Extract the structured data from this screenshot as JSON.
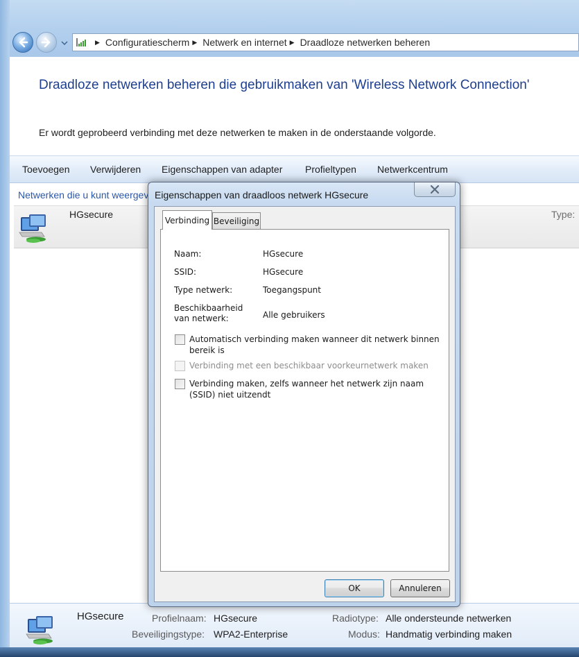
{
  "address_bar": {
    "crumbs": [
      "Configuratiescherm",
      "Netwerk en internet",
      "Draadloze netwerken beheren"
    ]
  },
  "page": {
    "title": "Draadloze netwerken beheren die gebruikmaken van 'Wireless Network Connection'",
    "description": "Er wordt geprobeerd verbinding met deze netwerken te maken in de onderstaande volgorde."
  },
  "toolbar": {
    "items": [
      "Toevoegen",
      "Verwijderen",
      "Eigenschappen van adapter",
      "Profieltypen",
      "Netwerkcentrum"
    ]
  },
  "network_list": {
    "header": "Netwerken die u kunt weergeven, wijzigen en opnieuw ordenen",
    "header_faint": "weergeven",
    "rows": [
      {
        "name": "HGsecure",
        "type_label": "Type:"
      }
    ]
  },
  "details": {
    "name": "HGsecure",
    "profile_name_label": "Profielnaam:",
    "profile_name": "HGsecure",
    "security_type_label": "Beveiligingstype:",
    "security_type": "WPA2-Enterprise",
    "radio_type_label": "Radiotype:",
    "radio_type": "Alle ondersteunde netwerken",
    "mode_label": "Modus:",
    "mode": "Handmatig verbinding maken"
  },
  "dialog": {
    "title": "Eigenschappen van draadloos netwerk HGsecure",
    "tabs": [
      "Verbinding",
      "Beveiliging"
    ],
    "active_tab": "Verbinding",
    "properties": [
      {
        "label": "Naam:",
        "value": "HGsecure"
      },
      {
        "label": "SSID:",
        "value": "HGsecure"
      },
      {
        "label": "Type netwerk:",
        "value": "Toegangspunt"
      },
      {
        "label": "Beschikbaarheid van netwerk:",
        "value": "Alle gebruikers"
      }
    ],
    "checkboxes": [
      {
        "label": "Automatisch verbinding maken wanneer dit netwerk binnen bereik is",
        "checked": false,
        "enabled": true
      },
      {
        "label": "Verbinding met een beschikbaar voorkeurnetwerk maken",
        "checked": false,
        "enabled": false
      },
      {
        "label": "Verbinding maken, zelfs wanneer het netwerk zijn naam (SSID) niet uitzendt",
        "checked": false,
        "enabled": true
      }
    ],
    "ok_label": "OK",
    "cancel_label": "Annuleren"
  },
  "icons": {
    "back": "back-arrow-icon",
    "forward": "forward-arrow-icon",
    "address": "network-signal-icon",
    "network": "wireless-computers-icon",
    "close": "close-icon"
  },
  "colors": {
    "title_blue": "#1e3f8f",
    "link_blue": "#2a57a8"
  }
}
